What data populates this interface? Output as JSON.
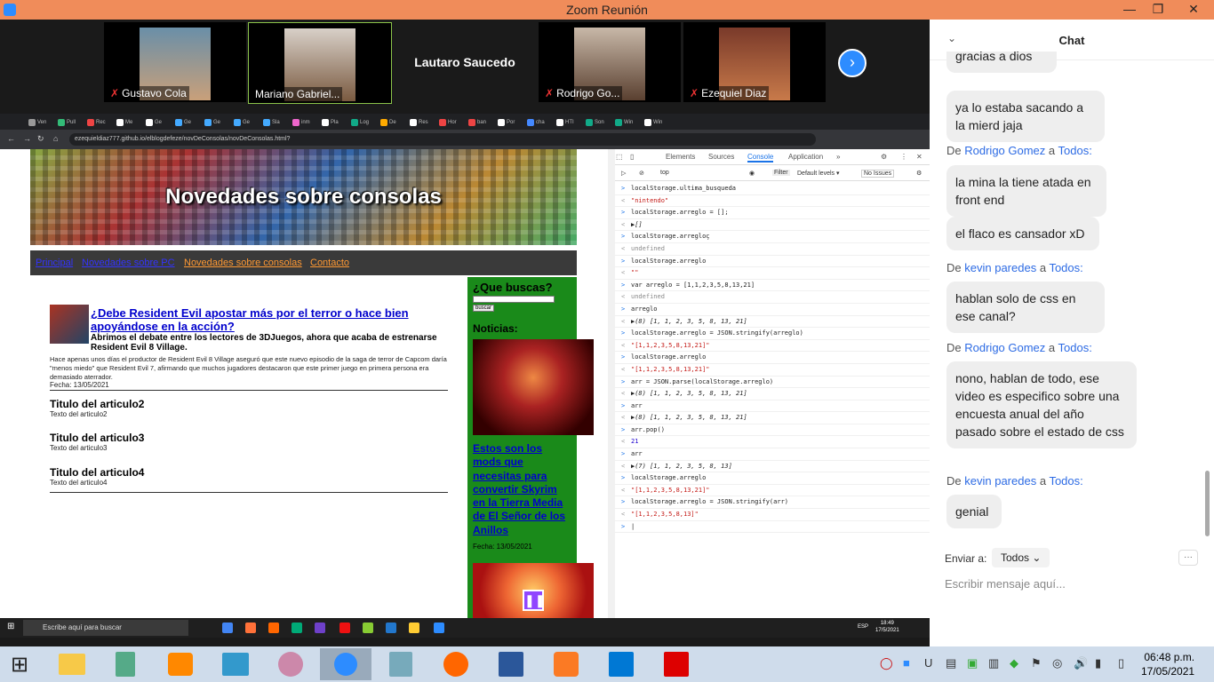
{
  "window": {
    "title": "Zoom Reunión"
  },
  "participants": [
    {
      "name": "Gustavo Cola",
      "muted": true
    },
    {
      "name": "Mariano Gabriel...",
      "muted": false,
      "active": true
    },
    {
      "name": "Lautaro Saucedo",
      "muted": false,
      "video": false
    },
    {
      "name": "Rodrigo Go...",
      "muted": true
    },
    {
      "name": "Ezequiel Diaz",
      "muted": true
    }
  ],
  "browser": {
    "url": "ezequieldiaz777.github.io/elblogdefeze/novDeConsolas/novDeConsolas.html?",
    "tabs": [
      "Ven",
      "Pull",
      "Rec",
      "Me",
      "Ge",
      "Ge",
      "Ge",
      "Ge",
      "Sla",
      "inm",
      "Pla",
      "Log",
      "De",
      "Res",
      "Hor",
      "ban",
      "Por",
      "cha",
      "HTI",
      "Son",
      "Win",
      "Win"
    ]
  },
  "webpage": {
    "banner_title": "Novedades sobre consolas",
    "nav": [
      "Principal",
      "Novedades sobre PC",
      "Novedades sobre consolas",
      "Contacto"
    ],
    "article1": {
      "title": "¿Debe Resident Evil apostar más por el terror o hace bien apoyándose en la acción?",
      "lead": "Abrimos el debate entre los lectores de 3DJuegos, ahora que acaba de estrenarse Resident Evil 8 Village.",
      "body": "Hace apenas unos días el productor de Resident Evil 8 Village aseguró que este nuevo episodio de la saga de terror de Capcom daría \"menos miedo\" que Resident Evil 7, afirmando que muchos jugadores destacaron que este primer juego en primera persona era demasiado aterrador.",
      "date": "Fecha: 13/05/2021"
    },
    "articles": [
      {
        "title": "Titulo del articulo2",
        "text": "Texto del articulo2"
      },
      {
        "title": "Titulo del articulo3",
        "text": "Texto del articulo3"
      },
      {
        "title": "Titulo del articulo4",
        "text": "Texto del articulo4"
      }
    ],
    "sidebar": {
      "question": "¿Que buscas?",
      "button": "buscar",
      "news_label": "Noticias:",
      "link": "Estos son los mods que necesitas para convertir Skyrim en la Tierra Media de El Señor de los Anillos",
      "date": "Fecha: 13/05/2021"
    }
  },
  "devtools": {
    "tabs": [
      "Elements",
      "Sources",
      "Console",
      "Application"
    ],
    "context": "top",
    "filter": "Filter",
    "levels": "Default levels ▾",
    "issues": "No Issues",
    "lines": [
      {
        "t": "in",
        "v": "localStorage.ultima_busqueda"
      },
      {
        "t": "str",
        "v": "\"nintendo\""
      },
      {
        "t": "in",
        "v": "localStorage.arreglo = [];"
      },
      {
        "t": "obj",
        "v": "▶[]"
      },
      {
        "t": "in",
        "v": "localStorage.arregloç"
      },
      {
        "t": "out",
        "v": "undefined"
      },
      {
        "t": "in",
        "v": "localStorage.arreglo"
      },
      {
        "t": "str",
        "v": "\"\""
      },
      {
        "t": "in",
        "v": "var arreglo = [1,1,2,3,5,8,13,21]"
      },
      {
        "t": "out",
        "v": "undefined"
      },
      {
        "t": "in",
        "v": "arreglo"
      },
      {
        "t": "obj",
        "v": "▶(8) [1, 1, 2, 3, 5, 8, 13, 21]"
      },
      {
        "t": "in",
        "v": "localStorage.arreglo = JSON.stringify(arreglo)"
      },
      {
        "t": "str",
        "v": "\"[1,1,2,3,5,8,13,21]\""
      },
      {
        "t": "in",
        "v": "localStorage.arreglo"
      },
      {
        "t": "str",
        "v": "\"[1,1,2,3,5,8,13,21]\""
      },
      {
        "t": "in",
        "v": "arr = JSON.parse(localStorage.arreglo)"
      },
      {
        "t": "obj",
        "v": "▶(8) [1, 1, 2, 3, 5, 8, 13, 21]"
      },
      {
        "t": "in",
        "v": "arr"
      },
      {
        "t": "obj",
        "v": "▶(8) [1, 1, 2, 3, 5, 8, 13, 21]"
      },
      {
        "t": "in",
        "v": "arr.pop()"
      },
      {
        "t": "num",
        "v": "21"
      },
      {
        "t": "in",
        "v": "arr"
      },
      {
        "t": "obj",
        "v": "▶(7) [1, 1, 2, 3, 5, 8, 13]"
      },
      {
        "t": "in",
        "v": "localStorage.arreglo"
      },
      {
        "t": "str",
        "v": "\"[1,1,2,3,5,8,13,21]\""
      },
      {
        "t": "in",
        "v": "localStorage.arreglo = JSON.stringify(arr)"
      },
      {
        "t": "str",
        "v": "\"[1,1,2,3,5,8,13]\""
      },
      {
        "t": "in",
        "v": "|"
      }
    ]
  },
  "inner_taskbar": {
    "search": "Escribe aquí para buscar",
    "lang": "ESP",
    "time": "18:49",
    "date": "17/5/2021"
  },
  "chat": {
    "title": "Chat",
    "messages": [
      {
        "type": "bubble",
        "text": "gracias a dios"
      },
      {
        "type": "bubble",
        "text": "ya lo estaba sacando a la mierd jaja"
      },
      {
        "type": "from",
        "user": "Rodrigo Gomez",
        "to": "Todos:"
      },
      {
        "type": "bubble",
        "text": "la mina la tiene atada en front end"
      },
      {
        "type": "bubble",
        "text": "el flaco es cansador xD"
      },
      {
        "type": "from",
        "user": "kevin paredes",
        "to": "Todos:"
      },
      {
        "type": "bubble",
        "text": "hablan solo de css en ese canal?"
      },
      {
        "type": "from",
        "user": "Rodrigo Gomez",
        "to": "Todos:"
      },
      {
        "type": "bubble",
        "text": "nono, hablan de todo, ese video es especifico sobre una encuesta anual del año pasado sobre el estado de css"
      },
      {
        "type": "from",
        "user": "kevin paredes",
        "to": "Todos:"
      },
      {
        "type": "bubble",
        "text": "genial"
      }
    ],
    "de": "De",
    "a": "a",
    "send_to_label": "Enviar a:",
    "send_to_value": "Todos",
    "placeholder": "Escribir mensaje aquí..."
  },
  "taskbar": {
    "time": "06:48 p.m.",
    "date": "17/05/2021"
  }
}
